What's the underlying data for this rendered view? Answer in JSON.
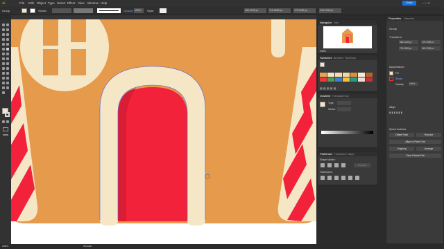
{
  "menu": {
    "app_icon": "Ai",
    "items": [
      "File",
      "Edit",
      "Object",
      "Type",
      "Select",
      "Effect",
      "View",
      "Window",
      "Help"
    ],
    "share": "Share"
  },
  "control": {
    "label": "Group",
    "stroke_label": "Stroke:",
    "opacity_label": "Opacity:",
    "opacity_value": "100%",
    "style_label": "Style:",
    "x": "466.2228 px",
    "y": "713.6083 px",
    "w": "175.9495 px",
    "h": "240.2036 px"
  },
  "navigator": {
    "tabs": [
      "Navigator",
      "Info"
    ],
    "zoom": "298%"
  },
  "swatches": {
    "tabs": [
      "Swatches",
      "Brushes",
      "Symbols"
    ],
    "colors": [
      "#e8a251",
      "#f2e5c6",
      "#f7ddae",
      "#f0d8a0",
      "#d98f3e",
      "#f5ecd6",
      "#b5622c",
      "#e53b3b",
      "#4d9e54",
      "#3a7fd0",
      "#f0c23a",
      "#2b9a8a",
      "#e8e0d0",
      "#c63030"
    ]
  },
  "gradient": {
    "tabs": [
      "Gradient",
      "Transparency"
    ],
    "type_label": "Type:",
    "stroke_label": "Stroke:"
  },
  "pathfinder": {
    "tabs": [
      "Pathfinder",
      "Transform",
      "Align"
    ],
    "shape_modes_label": "Shape Modes:",
    "pathfinders_label": "Pathfinders:",
    "expand_label": "Expand"
  },
  "properties": {
    "tabs": [
      "Properties",
      "Libraries"
    ],
    "group_label": "Group",
    "transform_label": "Transform",
    "x": "466.2228 px",
    "y": "713.6083 px",
    "w": "175.9495 px",
    "h": "240.2036 px",
    "appearance_label": "Appearance",
    "fill_label": "Fill",
    "stroke_label": "Stroke",
    "opacity_label": "Opacity",
    "opacity_value": "100%",
    "align_label": "Align",
    "quick_actions_label": "Quick Actions",
    "qa_offset": "Offset Path",
    "qa_recolor": "Recolor",
    "qa_pixel": "Align to Pixel Grid",
    "qa_ungroup": "Ungroup",
    "qa_arrange": "Arrange",
    "qa_global_edit": "Start Global Edit"
  },
  "status": {
    "zoom": "298%",
    "tool": "Smooth"
  },
  "accent": "#1473e6",
  "colors": {
    "door_red": "#f2223a",
    "door_shadow": "#d81d34",
    "cream": "#f5e6c6",
    "gingerbread": "#e69a4c"
  }
}
